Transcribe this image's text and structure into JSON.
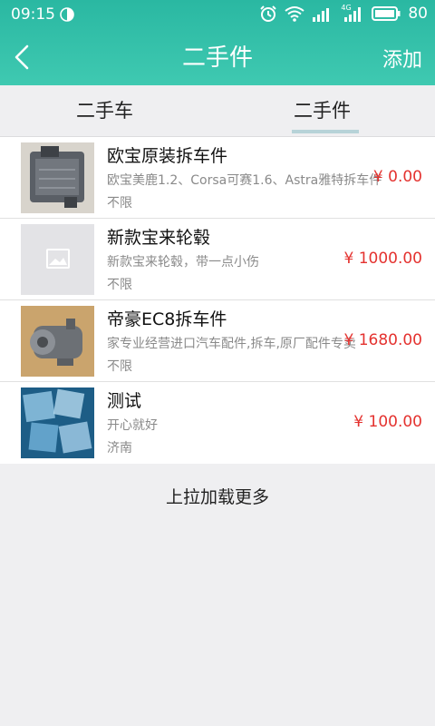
{
  "status": {
    "time": "09:15",
    "signal_label": "4G",
    "battery": "80"
  },
  "header": {
    "title": "二手件",
    "action": "添加"
  },
  "tabs": [
    {
      "label": "二手车",
      "active": false
    },
    {
      "label": "二手件",
      "active": true
    }
  ],
  "items": [
    {
      "name": "欧宝原装拆车件",
      "desc": "欧宝美鹿1.2、Corsa可赛1.6、Astra雅特拆车件",
      "price": "¥ 0.00",
      "location": "不限",
      "image": "ecu-module-photo"
    },
    {
      "name": "新款宝来轮毂",
      "desc": "新款宝来轮毂，带一点小伤",
      "price": "¥ 1000.00",
      "location": "不限",
      "image": "placeholder-image"
    },
    {
      "name": "帝豪EC8拆车件",
      "desc": "家专业经营进口汽车配件,拆车,原厂配件专卖",
      "price": "¥ 1680.00",
      "location": "不限",
      "image": "compressor-photo"
    },
    {
      "name": "测试",
      "desc": "开心就好",
      "price": "¥ 100.00",
      "location": "济南",
      "image": "ice-cubes-photo"
    }
  ],
  "load_more": "上拉加载更多",
  "colors": {
    "header": "#35c0a9",
    "price": "#e4322f"
  }
}
